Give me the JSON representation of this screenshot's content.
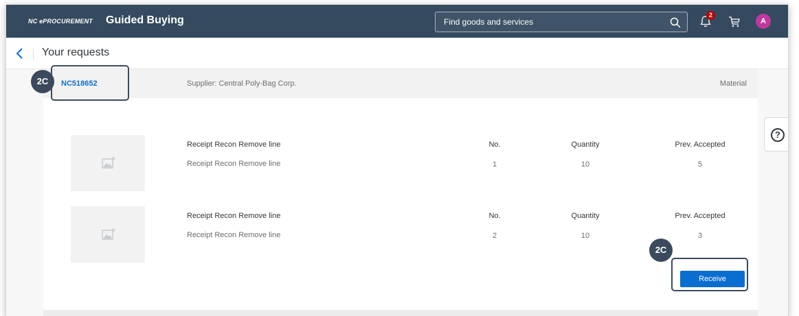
{
  "header": {
    "logo": "NC ePROCUREMENT",
    "title": "Guided Buying",
    "search_placeholder": "Find goods and services",
    "notification_count": "2",
    "avatar_initial": "A"
  },
  "subheader": {
    "title": "Your requests"
  },
  "request": {
    "id": "NC518652",
    "supplier": "Supplier: Central Poly-Bag Corp.",
    "type": "Material"
  },
  "items": [
    {
      "name": "Receipt Recon Remove line",
      "description": "Receipt Recon Remove line",
      "no_label": "No.",
      "no": "1",
      "qty_label": "Quantity",
      "qty": "10",
      "prev_label": "Prev. Accepted",
      "prev": "5"
    },
    {
      "name": "Receipt Recon Remove line",
      "description": "Receipt Recon Remove line",
      "no_label": "No.",
      "no": "2",
      "qty_label": "Quantity",
      "qty": "10",
      "prev_label": "Prev. Accepted",
      "prev": "3"
    }
  ],
  "actions": {
    "receive_label": "Receive"
  },
  "help": {
    "symbol": "?"
  },
  "callouts": {
    "first": "2C",
    "second": "2C"
  },
  "colors": {
    "header_bg": "#354a5f",
    "link": "#0a6ed1",
    "primary_button": "#0a6ed1",
    "callout": "#3b4a5c",
    "badge": "#bb0000",
    "avatar": "#c0399f"
  },
  "icons": {
    "search": "search-icon",
    "notification": "bell-icon",
    "cart": "cart-icon",
    "back": "chevron-left-icon",
    "image_placeholder": "image-placeholder-icon",
    "help": "help-icon"
  }
}
